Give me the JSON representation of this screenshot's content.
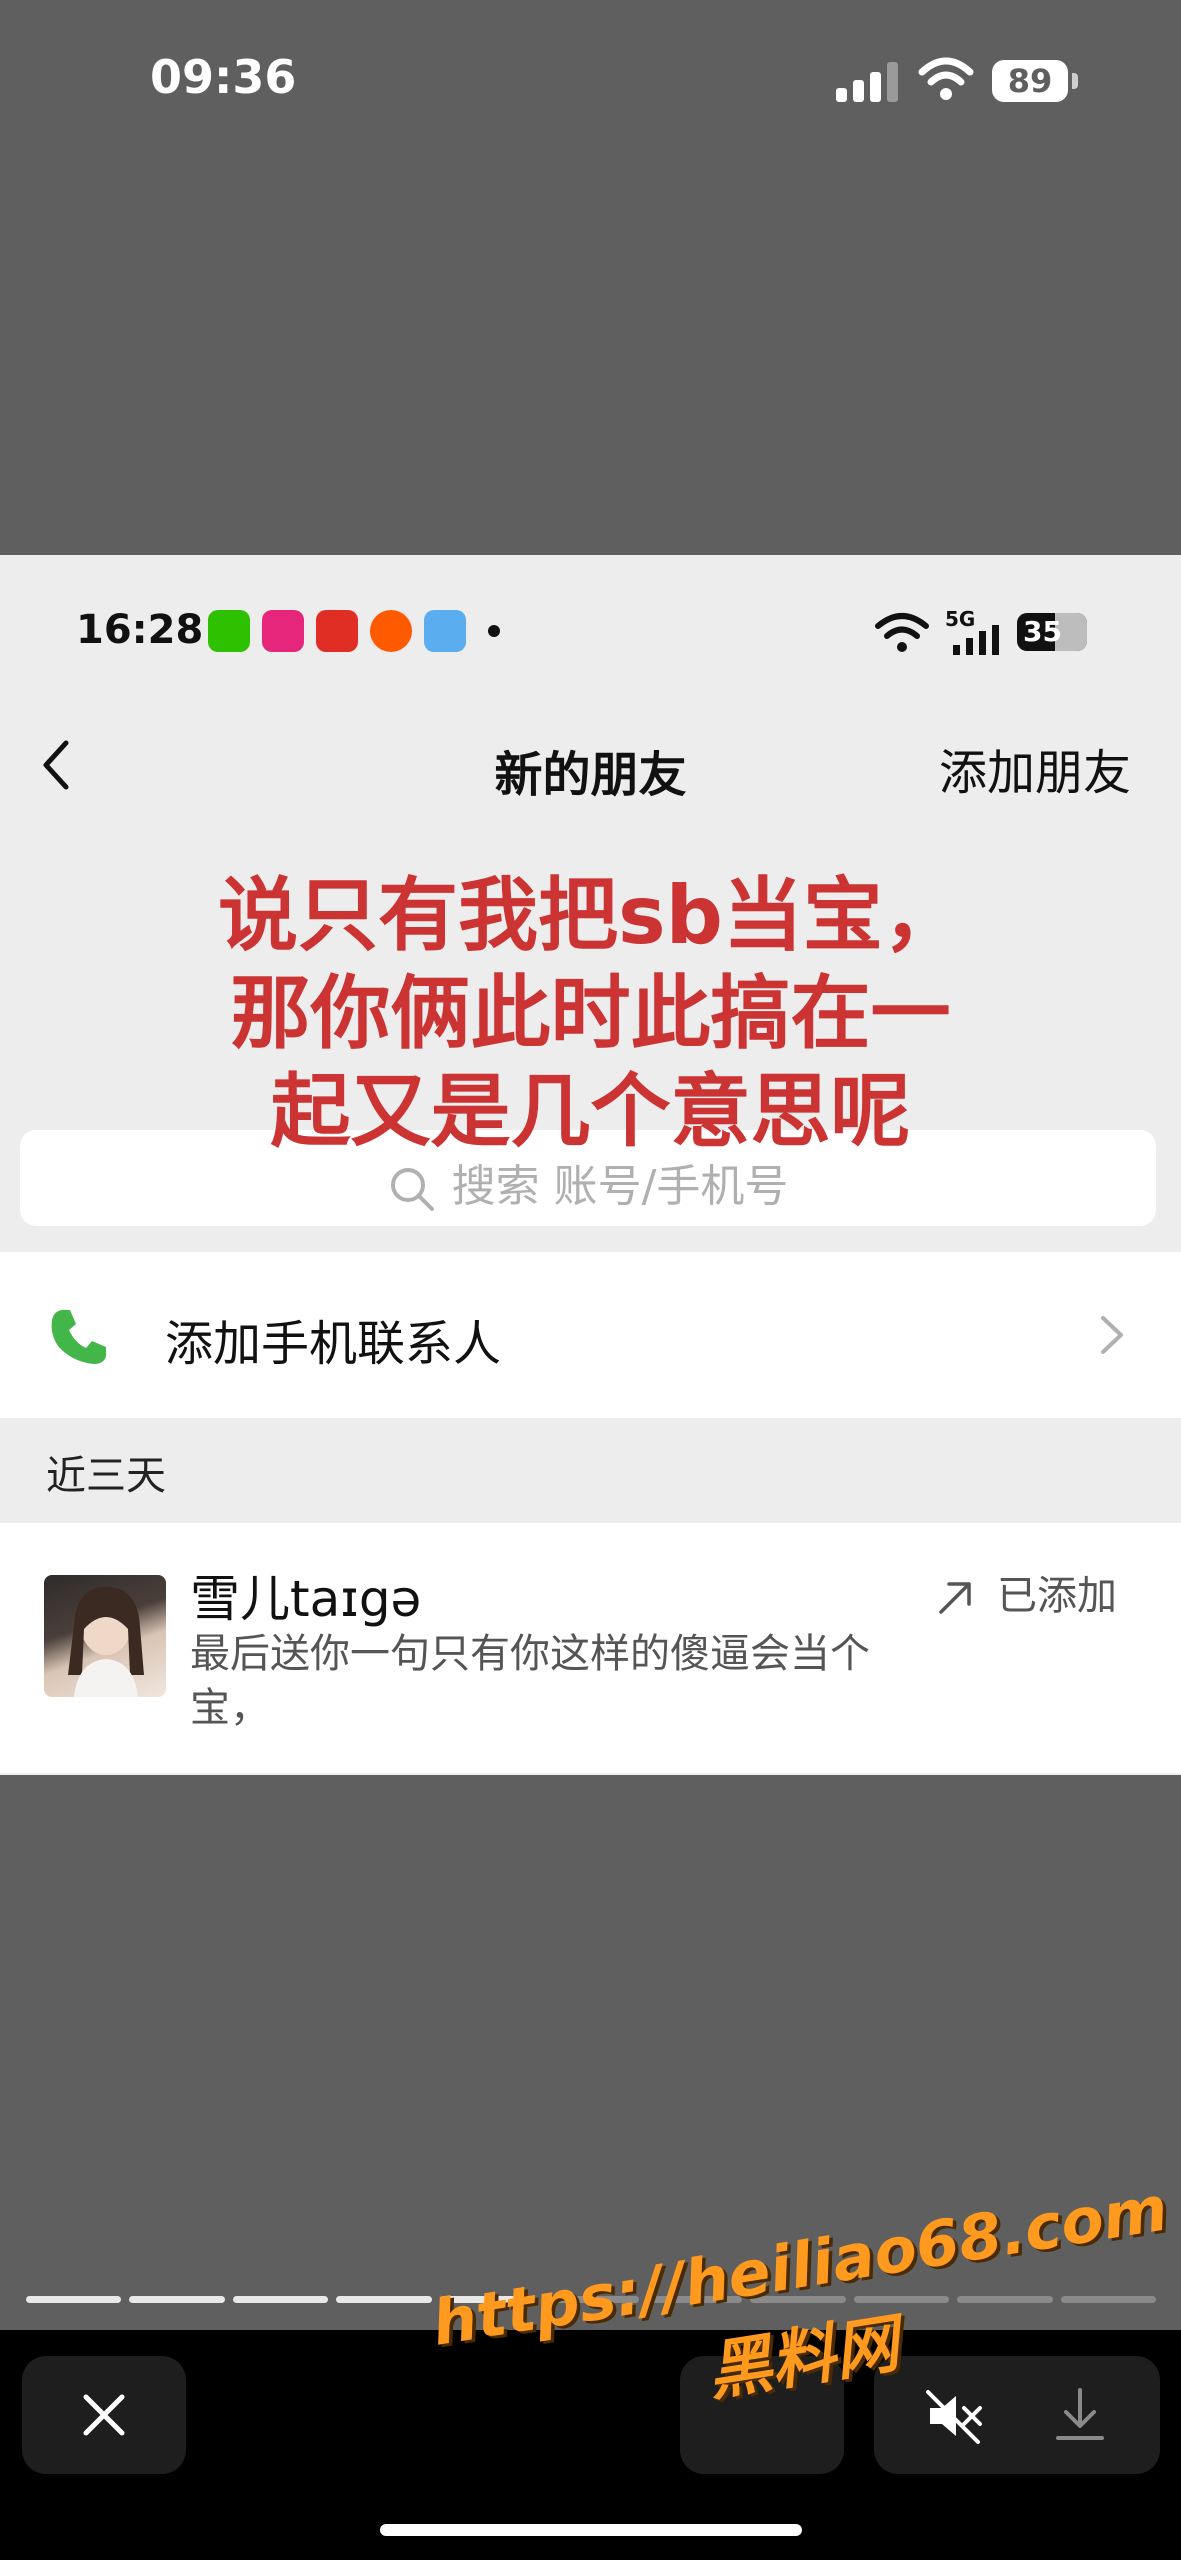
{
  "outer_status": {
    "time": "09:36",
    "battery": "89"
  },
  "inner_status": {
    "time": "16:28",
    "network": "5G",
    "battery": "35"
  },
  "nav": {
    "title": "新的朋友",
    "add_friend": "添加朋友"
  },
  "overlay_caption": [
    "说只有我把sb当宝，",
    "那你俩此时此搞在一",
    "起又是几个意思呢"
  ],
  "search": {
    "placeholder": "搜索 账号/手机号"
  },
  "add_contact": {
    "label": "添加手机联系人"
  },
  "section": {
    "label": "近三天"
  },
  "friend": {
    "name": "雪儿taɪgə",
    "message": "最后送你一句只有你这样的傻逼会当个宝，",
    "status": "已添加"
  },
  "progress": {
    "segments": 11,
    "completed": 5
  },
  "watermark": {
    "url": "https://heiliao68.com",
    "name": "黑料网"
  },
  "colors": {
    "overlay_text": "#cc3333",
    "watermark": "#ff9a1f",
    "phone_icon": "#43b649"
  }
}
